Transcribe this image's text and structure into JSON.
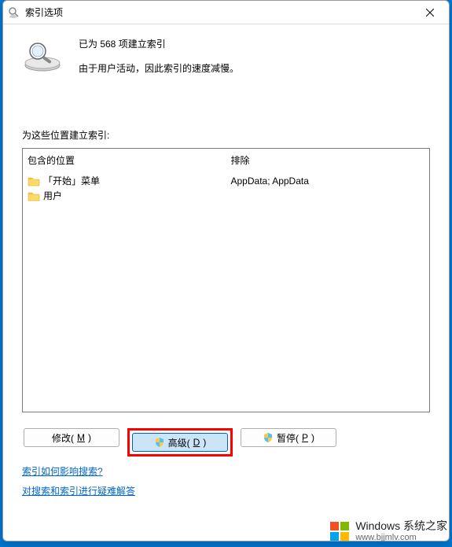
{
  "window": {
    "title": "索引选项"
  },
  "status": {
    "line1": "已为 568 项建立索引",
    "line2": "由于用户活动，因此索引的速度减慢。"
  },
  "sectionLabel": "为这些位置建立索引:",
  "columns": {
    "includedHeader": "包含的位置",
    "excludeHeader": "排除",
    "includedItems": [
      {
        "label": "「开始」菜单"
      },
      {
        "label": "用户"
      }
    ],
    "excludeItems": [
      "",
      "AppData; AppData"
    ]
  },
  "buttons": {
    "modify": "修改(",
    "modifyKey": "M",
    "modifySuffix": ")",
    "advanced": "高级(",
    "advancedKey": "D",
    "advancedSuffix": ")",
    "pause": "暂停(",
    "pauseKey": "P",
    "pauseSuffix": ")"
  },
  "links": {
    "link1": "索引如何影响搜索?",
    "link2": "对搜索和索引进行疑难解答"
  },
  "watermark": {
    "main": "Windows 系统之家",
    "sub": "www.bjjmlv.com"
  }
}
